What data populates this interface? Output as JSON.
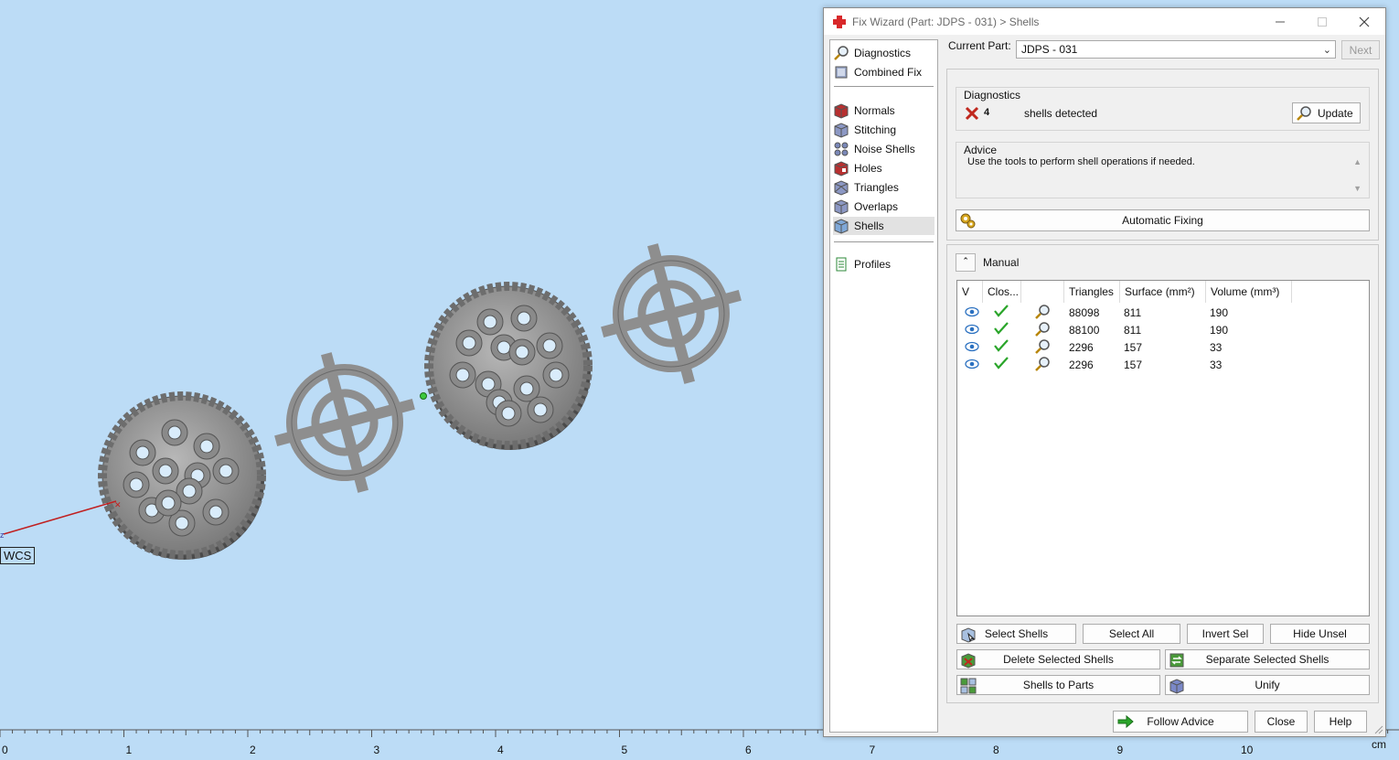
{
  "viewport": {
    "wcs_label": "WCS",
    "ruler": {
      "unit": "cm",
      "ticks": [
        "0",
        "1",
        "2",
        "3",
        "4",
        "5",
        "6",
        "7",
        "8",
        "9",
        "10"
      ]
    }
  },
  "dialog": {
    "title": "Fix Wizard (Part: JDPS - 031) > Shells",
    "window_buttons": [
      "minimize",
      "maximize",
      "close"
    ],
    "nav": {
      "items": [
        {
          "label": "Diagnostics",
          "icon": "magnifier-icon"
        },
        {
          "label": "Combined Fix",
          "icon": "combined-fix-icon"
        },
        {
          "label": "Normals",
          "icon": "normals-cube-icon"
        },
        {
          "label": "Stitching",
          "icon": "stitching-cube-icon"
        },
        {
          "label": "Noise Shells",
          "icon": "noise-shells-icon"
        },
        {
          "label": "Holes",
          "icon": "holes-cube-icon"
        },
        {
          "label": "Triangles",
          "icon": "triangles-cube-icon"
        },
        {
          "label": "Overlaps",
          "icon": "overlaps-cube-icon"
        },
        {
          "label": "Shells",
          "icon": "shells-cube-icon"
        },
        {
          "label": "Profiles",
          "icon": "profiles-document-icon"
        }
      ],
      "active": "Shells"
    },
    "current_part": {
      "label": "Current Part:",
      "value": "JDPS - 031"
    },
    "next_label": "Next",
    "diagnostics": {
      "title": "Diagnostics",
      "count": "4",
      "message": "shells detected",
      "update_label": "Update"
    },
    "advice": {
      "title": "Advice",
      "text": "Use the tools to perform shell operations if needed."
    },
    "automatic_fixing_label": "Automatic Fixing",
    "manual": {
      "title": "Manual",
      "table": {
        "headers": [
          "V",
          "Clos...",
          "",
          "Triangles",
          "Surface (mm²)",
          "Volume (mm³)"
        ],
        "rows": [
          {
            "triangles": "88098",
            "surface": "811",
            "volume": "190"
          },
          {
            "triangles": "88100",
            "surface": "811",
            "volume": "190"
          },
          {
            "triangles": "2296",
            "surface": "157",
            "volume": "33"
          },
          {
            "triangles": "2296",
            "surface": "157",
            "volume": "33"
          }
        ]
      },
      "buttons": {
        "select_shells": "Select Shells",
        "select_all": "Select All",
        "invert_sel": "Invert Sel",
        "hide_unsel": "Hide Unsel",
        "delete_selected": "Delete Selected Shells",
        "separate_selected": "Separate Selected Shells",
        "shells_to_parts": "Shells to Parts",
        "unify": "Unify"
      }
    },
    "footer": {
      "follow_advice": "Follow Advice",
      "close": "Close",
      "help": "Help"
    }
  },
  "colors": {
    "viewport_bg": "#bcdcf6",
    "part_gray": "#8c8c8c",
    "check_green": "#2aa52a",
    "error_red": "#c0281e",
    "title_icon_red": "#d8282a"
  }
}
